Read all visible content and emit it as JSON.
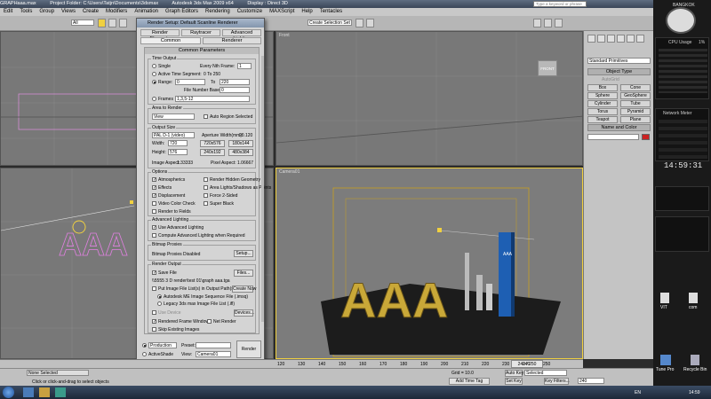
{
  "title_bar": {
    "file": "GRAPHaaa.max",
    "project": "Project Folder: C:\\Users\\Tatjn\\Documents\\3dsmax",
    "app": "Autodesk 3ds Max  2009 x64",
    "display": "Display : Direct 3D",
    "search_placeholder": "Type a keyword or phrase"
  },
  "menu": [
    "Edit",
    "Tools",
    "Group",
    "Views",
    "Create",
    "Modifiers",
    "Animation",
    "Graph Editors",
    "Rendering",
    "Customize",
    "MAXScript",
    "Help",
    "Tentacles"
  ],
  "toolbar": {
    "selection_filter": "All",
    "named_selection": "Create Selection Set"
  },
  "viewports": {
    "top_right_label": "Front",
    "bottom_left_label": "Left",
    "camera_label": "Camera01",
    "view_cube_label": "FRONT",
    "text_object": "AAA",
    "box_label": "AAA"
  },
  "dialog": {
    "title": "Render Setup: Default Scanline Renderer",
    "tabs_row1": [
      "Render Elements",
      "Raytracer",
      "Advanced Lighting"
    ],
    "tabs_row2": [
      "Common",
      "Renderer"
    ],
    "common_parameters": "Common Parameters",
    "time_output": {
      "label": "Time Output",
      "single": "Single",
      "every_nth": "Every Nth Frame:",
      "every_nth_value": "1",
      "active_segment": "Active Time Segment:",
      "active_segment_value": "0 To 250",
      "range": "Range:",
      "range_from": "0",
      "range_to_label": "To",
      "range_to": "220",
      "file_number_base": "File Number Base:",
      "file_number_base_value": "0",
      "frames": "Frames",
      "frames_value": "1,3,5-12"
    },
    "area_to_render": {
      "label": "Area to Render",
      "value": "View",
      "auto_region": "Auto Region Selected"
    },
    "output_size": {
      "label": "Output Size",
      "preset": "PAL D-1 (video)",
      "aperture_label": "Aperture Width(mm):",
      "aperture_value": "20.120",
      "width_label": "Width:",
      "width": "720",
      "height_label": "Height:",
      "height": "576",
      "presets": [
        "720x576",
        "180x144",
        "240x192",
        "480x384"
      ],
      "image_aspect_label": "Image Aspect:",
      "image_aspect": "1.33333",
      "pixel_aspect_label": "Pixel Aspect:",
      "pixel_aspect": "1.06667"
    },
    "options": {
      "label": "Options",
      "items": [
        {
          "label": "Atmospherics",
          "checked": true
        },
        {
          "label": "Render Hidden Geometry",
          "checked": false
        },
        {
          "label": "Effects",
          "checked": true
        },
        {
          "label": "Area Lights/Shadows as Points",
          "checked": false
        },
        {
          "label": "Displacement",
          "checked": true
        },
        {
          "label": "Force 2-Sided",
          "checked": false
        },
        {
          "label": "Video Color Check",
          "checked": false
        },
        {
          "label": "Super Black",
          "checked": false
        },
        {
          "label": "Render to Fields",
          "checked": false
        }
      ]
    },
    "advanced_lighting": {
      "label": "Advanced Lighting",
      "use": "Use Advanced Lighting",
      "compute": "Compute Advanced Lighting when Required"
    },
    "bitmap_proxies": {
      "label": "Bitmap Proxies",
      "status": "Bitmap Proxies Disabled",
      "setup": "Setup..."
    },
    "render_output": {
      "label": "Render Output",
      "save_file": "Save File",
      "files_btn": "Files...",
      "path": "\\\\5555 3 D render\\test 01\\graph aaa.tga",
      "put_image": "Put Image File List(s) in Output Path(s)",
      "create_now": "Create Now",
      "autodesk_seq": "Autodesk ME Image Sequence File (.imsq)",
      "legacy": "Legacy 3ds max Image File List (.ifl)",
      "use_device": "Use Device",
      "devices": "Devices...",
      "rendered_frame_window": "Rendered Frame Window",
      "net_render": "Net Render",
      "skip_existing": "Skip Existing Images"
    },
    "footer": {
      "production": "Production",
      "activeshade": "ActiveShade",
      "preset_label": "Preset:",
      "view_label": "View:",
      "view_value": "Camera01",
      "render": "Render"
    }
  },
  "command_panel": {
    "dropdown": "Standard Primitives",
    "object_type": "Object Type",
    "autogrid": "AutoGrid",
    "buttons": [
      "Box",
      "Cone",
      "Sphere",
      "GeoSphere",
      "Cylinder",
      "Tube",
      "Torus",
      "Pyramid",
      "Teapot",
      "Plane"
    ],
    "name_and_color": "Name and Color",
    "accent": "#cc2222"
  },
  "timeline": {
    "frame_counter": "240 / 250",
    "ticks": [
      "120",
      "130",
      "140",
      "150",
      "160",
      "170",
      "180",
      "190",
      "200",
      "210",
      "220",
      "230",
      "240",
      "250"
    ]
  },
  "status_bar": {
    "selection": "None Selected",
    "prompt": "Click or click-and-drag to select objects",
    "grid": "Grid = 10.0",
    "add_time_tag": "Add Time Tag",
    "auto_key": "Auto Key",
    "auto_key_value": "Selected",
    "set_key": "Set Key",
    "key_filters": "Key Filters...",
    "frame": "240"
  },
  "sidebar": {
    "city": "BANGKOK",
    "clock": "14:59:31",
    "cpu_title": "CPU Usage",
    "cpu_pct": "1%",
    "network_title": "Network Meter",
    "clock2": "14:59:31",
    "desktop_icons": [
      "VIT",
      "com",
      "Tune Pro",
      "Recycle Bin"
    ]
  },
  "taskbar": {
    "lang": "EN",
    "time": "14:59"
  }
}
